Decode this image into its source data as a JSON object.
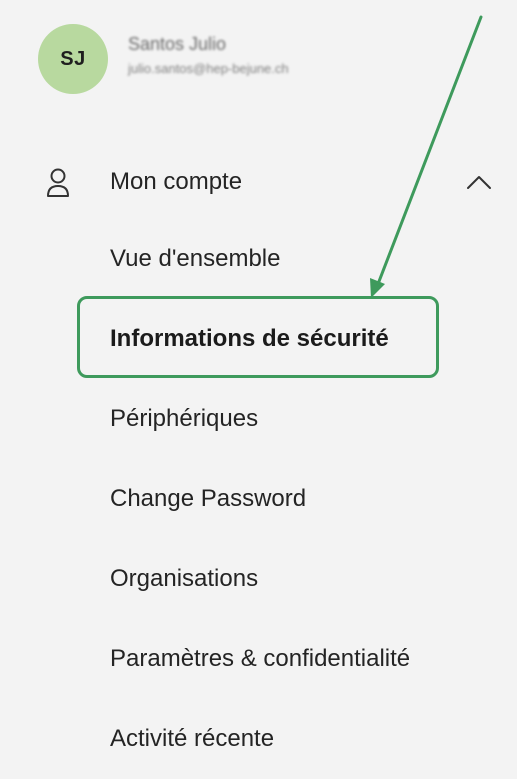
{
  "user": {
    "initials": "SJ",
    "name": "Santos Julio",
    "email": "julio.santos@hep-bejune.ch"
  },
  "section": {
    "label": "Mon compte",
    "icon": "person-icon",
    "expanded": true
  },
  "menu": {
    "items": [
      {
        "label": "Vue d'ensemble",
        "active": false
      },
      {
        "label": "Informations de sécurité",
        "active": true
      },
      {
        "label": "Périphériques",
        "active": false
      },
      {
        "label": "Change Password",
        "active": false
      },
      {
        "label": "Organisations",
        "active": false
      },
      {
        "label": "Paramètres & confidentialité",
        "active": false
      },
      {
        "label": "Activité récente",
        "active": false
      }
    ]
  },
  "colors": {
    "background": "#f3f3f3",
    "avatar_bg": "#b8d99f",
    "highlight": "#3e9a5c"
  }
}
